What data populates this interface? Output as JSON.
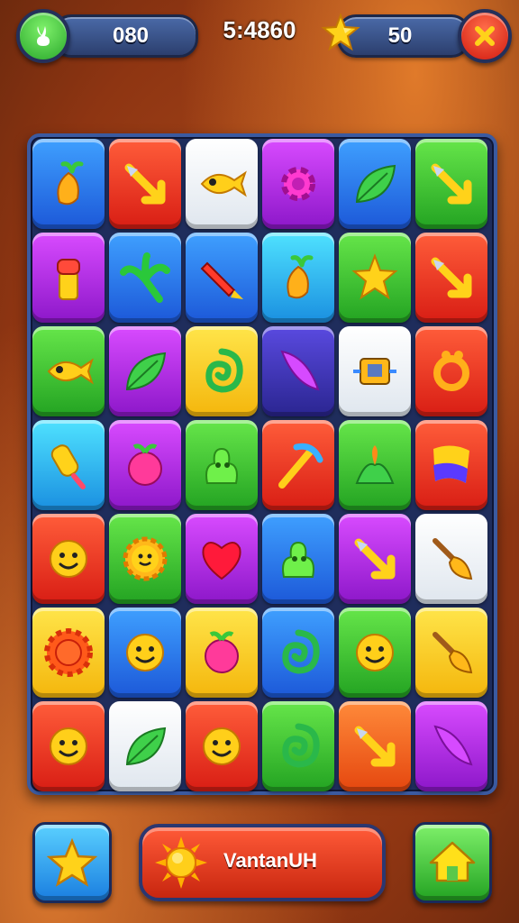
{
  "hud": {
    "coins": "080",
    "score": "5:4860",
    "stars": "50"
  },
  "player": {
    "name": "VantanUH"
  },
  "board": {
    "rows": [
      [
        {
          "color": "blue",
          "icon": "carrot-icon"
        },
        {
          "color": "red",
          "icon": "arrow-icon"
        },
        {
          "color": "white",
          "icon": "fish-icon"
        },
        {
          "color": "purple",
          "icon": "gear-icon"
        },
        {
          "color": "blue",
          "icon": "leaf-icon"
        },
        {
          "color": "green",
          "icon": "arrow-icon"
        }
      ],
      [
        {
          "color": "purple",
          "icon": "bottle-icon"
        },
        {
          "color": "blue",
          "icon": "palm-leaf-icon"
        },
        {
          "color": "blue",
          "icon": "rocket-icon"
        },
        {
          "color": "cyan",
          "icon": "carrot-icon"
        },
        {
          "color": "green",
          "icon": "star-icon"
        },
        {
          "color": "red",
          "icon": "arrow-icon"
        }
      ],
      [
        {
          "color": "green",
          "icon": "fish-icon"
        },
        {
          "color": "purple",
          "icon": "leaf-icon"
        },
        {
          "color": "yellow",
          "icon": "swirl-icon"
        },
        {
          "color": "navy",
          "icon": "feather-icon"
        },
        {
          "color": "white",
          "icon": "robot-icon"
        },
        {
          "color": "red",
          "icon": "ring-icon"
        }
      ],
      [
        {
          "color": "cyan",
          "icon": "popsicle-icon"
        },
        {
          "color": "purple",
          "icon": "berry-icon"
        },
        {
          "color": "green",
          "icon": "blob-icon"
        },
        {
          "color": "red",
          "icon": "pickaxe-icon"
        },
        {
          "color": "green",
          "icon": "sprout-icon"
        },
        {
          "color": "red",
          "icon": "flag-icon"
        }
      ],
      [
        {
          "color": "red",
          "icon": "smiley-icon"
        },
        {
          "color": "green",
          "icon": "sun-face-icon"
        },
        {
          "color": "purple",
          "icon": "heart-icon"
        },
        {
          "color": "blue",
          "icon": "blob-icon"
        },
        {
          "color": "purple",
          "icon": "arrow-icon"
        },
        {
          "color": "white",
          "icon": "brush-icon"
        }
      ],
      [
        {
          "color": "yellow",
          "icon": "sun-icon"
        },
        {
          "color": "blue",
          "icon": "smiley-icon"
        },
        {
          "color": "yellow",
          "icon": "berry-icon"
        },
        {
          "color": "blue",
          "icon": "swirl-icon"
        },
        {
          "color": "green",
          "icon": "smiley-icon"
        },
        {
          "color": "yellow",
          "icon": "brush-icon"
        }
      ],
      [
        {
          "color": "red",
          "icon": "smiley-icon"
        },
        {
          "color": "white",
          "icon": "leaf-icon"
        },
        {
          "color": "red",
          "icon": "smiley-icon"
        },
        {
          "color": "green",
          "icon": "swirl-icon"
        },
        {
          "color": "orange",
          "icon": "arrow-icon"
        },
        {
          "color": "purple",
          "icon": "feather-icon"
        }
      ]
    ]
  },
  "colors": {
    "hud_pill": "#2c3f6e",
    "accent_red": "#d81d14",
    "accent_green": "#23a322",
    "star_yellow": "#ffd21a"
  }
}
